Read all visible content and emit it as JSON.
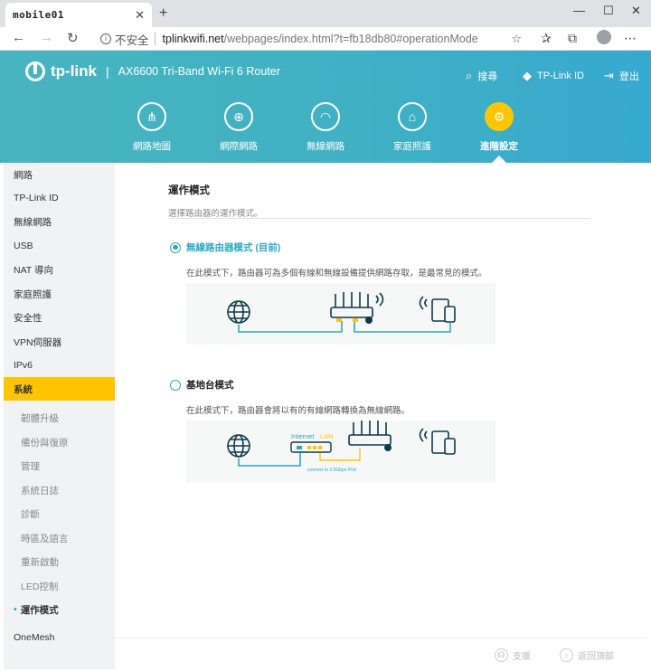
{
  "browser": {
    "tab_title": "mobile01",
    "address_insecure": "不安全",
    "address_host": "tplinkwifi.net",
    "address_path": "/webpages/index.html?t=fb18db80#operationMode"
  },
  "header": {
    "brand": "tp-link",
    "divider": "|",
    "model": "AX6600 Tri-Band Wi-Fi 6 Router",
    "search_label": "搜尋",
    "tplink_id_label": "TP-Link ID",
    "logout_label": "登出"
  },
  "menu": [
    {
      "label": "網路地圖"
    },
    {
      "label": "網際網路"
    },
    {
      "label": "無線網路"
    },
    {
      "label": "家庭照護"
    },
    {
      "label": "進階設定"
    }
  ],
  "sidebar": {
    "items": [
      {
        "label": "網路"
      },
      {
        "label": "TP-Link ID"
      },
      {
        "label": "無線網路"
      },
      {
        "label": "USB"
      },
      {
        "label": "NAT 導向"
      },
      {
        "label": "家庭照護"
      },
      {
        "label": "安全性"
      },
      {
        "label": "VPN伺服器"
      },
      {
        "label": "IPv6"
      },
      {
        "label": "系統"
      }
    ],
    "sub_items": [
      {
        "label": "韌體升級"
      },
      {
        "label": "備份與復原"
      },
      {
        "label": "管理"
      },
      {
        "label": "系統日誌"
      },
      {
        "label": "診斷"
      },
      {
        "label": "時區及語言"
      },
      {
        "label": "重新啟動"
      },
      {
        "label": "LED控制"
      },
      {
        "label": "運作模式"
      }
    ],
    "bottom_item": "OneMesh"
  },
  "content": {
    "title": "運作模式",
    "description": "選擇路由器的運作模式。",
    "router_mode": {
      "label": "無線路由器模式 (目前)",
      "description": "在此模式下，路由器可為多個有線和無線設備提供網路存取，是最常見的模式。",
      "selected": true
    },
    "ap_mode": {
      "label": "基地台模式",
      "description": "在此模式下，路由器會將以有的有線網路轉換為無線網路。",
      "selected": false,
      "diagram_text": {
        "internet": "Internet",
        "lan": "LAN",
        "connect": "connect to 2.5Gbps Port"
      }
    }
  },
  "footer": {
    "support_label": "支援",
    "back_to_top_label": "返回頂部"
  },
  "colors": {
    "accent": "#2aa9c6",
    "active": "#ffc600",
    "header": "#3fb1c4"
  }
}
